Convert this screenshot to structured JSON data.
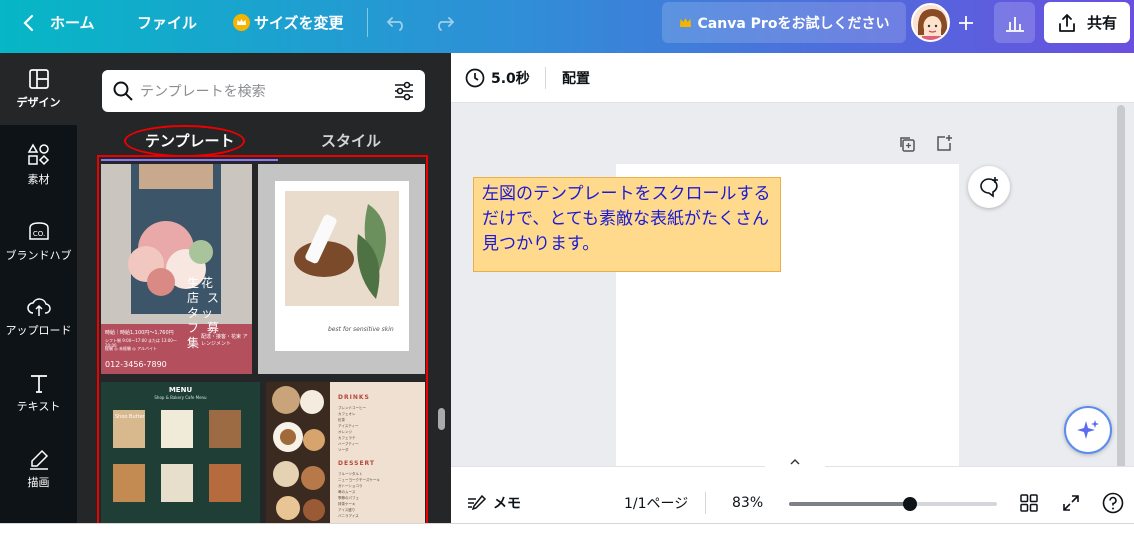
{
  "topbar": {
    "home_label": "ホーム",
    "file_label": "ファイル",
    "resize_label": "サイズを変更",
    "pro_label": "Canva Proをお試しください",
    "share_label": "共有"
  },
  "rail": {
    "items": [
      {
        "label": "デザイン",
        "icon": "layout-icon"
      },
      {
        "label": "素材",
        "icon": "shapes-icon"
      },
      {
        "label": "ブランドハブ",
        "icon": "brand-icon"
      },
      {
        "label": "アップロード",
        "icon": "upload-cloud-icon"
      },
      {
        "label": "テキスト",
        "icon": "text-icon"
      },
      {
        "label": "描画",
        "icon": "draw-icon"
      }
    ]
  },
  "panel": {
    "search_placeholder": "テンプレートを検索",
    "tabs": [
      "テンプレート",
      "スタイル"
    ],
    "templates": [
      {
        "name": "flower-shop-recruit",
        "title": "生花店 スタッフ 募集",
        "detail": "時給｜時給1,100円〜1,760円",
        "sub1": "シフト制 9:00〜17:00 または 13:00〜20:00",
        "sub2": "経験 ◎ 未経験 ◎ アルバイト",
        "tagline": "配達・接客・花束 アレンジメント",
        "phone": "012-3456-7890"
      },
      {
        "name": "skin-care-product",
        "tagline": "best for sensitive skin"
      },
      {
        "name": "cafe-menu-green",
        "menu_title": "MENU",
        "menu_sub": "Shop & Bakery Cafe Menu",
        "item1": "Shoo Butter"
      },
      {
        "name": "drinks-dessert-menu",
        "drinks_label": "DRINKS",
        "dessert_label": "DESSERT",
        "drinks": [
          "ブレンドコーヒー",
          "カフェオレ",
          "紅茶",
          "アイスティー",
          "オレンジ",
          "カフェラテ",
          "ハーブティー",
          "ソーダ"
        ],
        "desserts": [
          "フルーツタルト",
          "ニューヨークチーズケーキ",
          "ガトーショコラ",
          "苺のムース",
          "季節のパフェ",
          "抹茶ケーキ",
          "アイス盛り",
          "バニラアイス"
        ]
      }
    ]
  },
  "editor": {
    "duration": "5.0秒",
    "position_label": "配置",
    "note_text": "左図のテンプレートをスクロールするだけで、とても素敵な表紙がたくさん見つかります。"
  },
  "footer": {
    "notes_label": "メモ",
    "page_label": "1/1ページ",
    "zoom_label": "83%",
    "zoom_level": 0.58
  },
  "colors": {
    "accent": "#8b3dff",
    "annotation_red": "#ee0000",
    "note_bg": "#ffd98c",
    "note_text": "#1b1bd6"
  }
}
